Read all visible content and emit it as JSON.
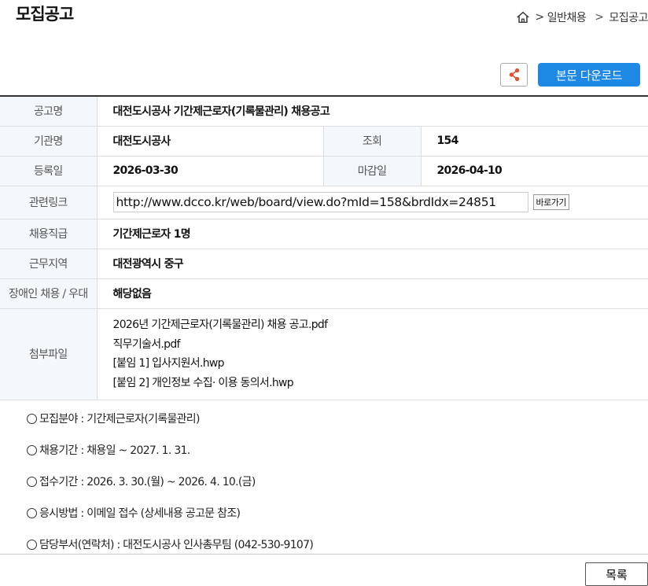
{
  "header": {
    "title": "모집공고",
    "breadcrumb": [
      ">",
      "일반채용",
      ">",
      "모집공고"
    ]
  },
  "toolbar": {
    "share_icon": "share-icon",
    "download_label": "본문 다운로드"
  },
  "info": {
    "title_label": "공고명",
    "title_value": "대전도시공사 기간제근로자(기록물관리) 채용공고",
    "org_label": "기관명",
    "org_value": "대전도시공사",
    "views_label": "조회",
    "views_value": "154",
    "reg_label": "등록일",
    "reg_value": "2026-03-30",
    "deadline_label": "마감일",
    "deadline_value": "2026-04-10",
    "link_label": "관련링크",
    "link_value": "http://www.dcco.kr/web/board/view.do?mId=158&brdIdx=24851",
    "link_button": "바로가기",
    "job_label": "채용직급",
    "job_value": "기간제근로자 1명",
    "region_label": "근무지역",
    "region_value": "대전광역시 중구",
    "disabled_label": "장애인 채용 / 우대",
    "disabled_value": "해당없음",
    "files_label": "첨부파일",
    "files": [
      "2026년 기간제근로자(기록물관리) 채용 공고.pdf",
      "직무기술서.pdf",
      "[붙임 1] 입사지원서.hwp",
      "[붙임 2] 개인정보 수집· 이용 동의서.hwp"
    ]
  },
  "details": [
    "모집분야 : 기간제근로자(기록물관리)",
    "채용기간 : 채용일 ~ 2027. 1. 31.",
    "접수기간 : 2026. 3. 30.(월) ~ 2026. 4. 10.(금)",
    "응시방법 : 이메일 접수 (상세내용 공고문 참조)",
    "담당부서(연락처) : 대전도시공사 인사총무팀 (042-530-9107)"
  ],
  "footer": {
    "list_label": "목록"
  },
  "colors": {
    "accent": "#1e88e5",
    "header_bg": "#f4f7fb"
  }
}
